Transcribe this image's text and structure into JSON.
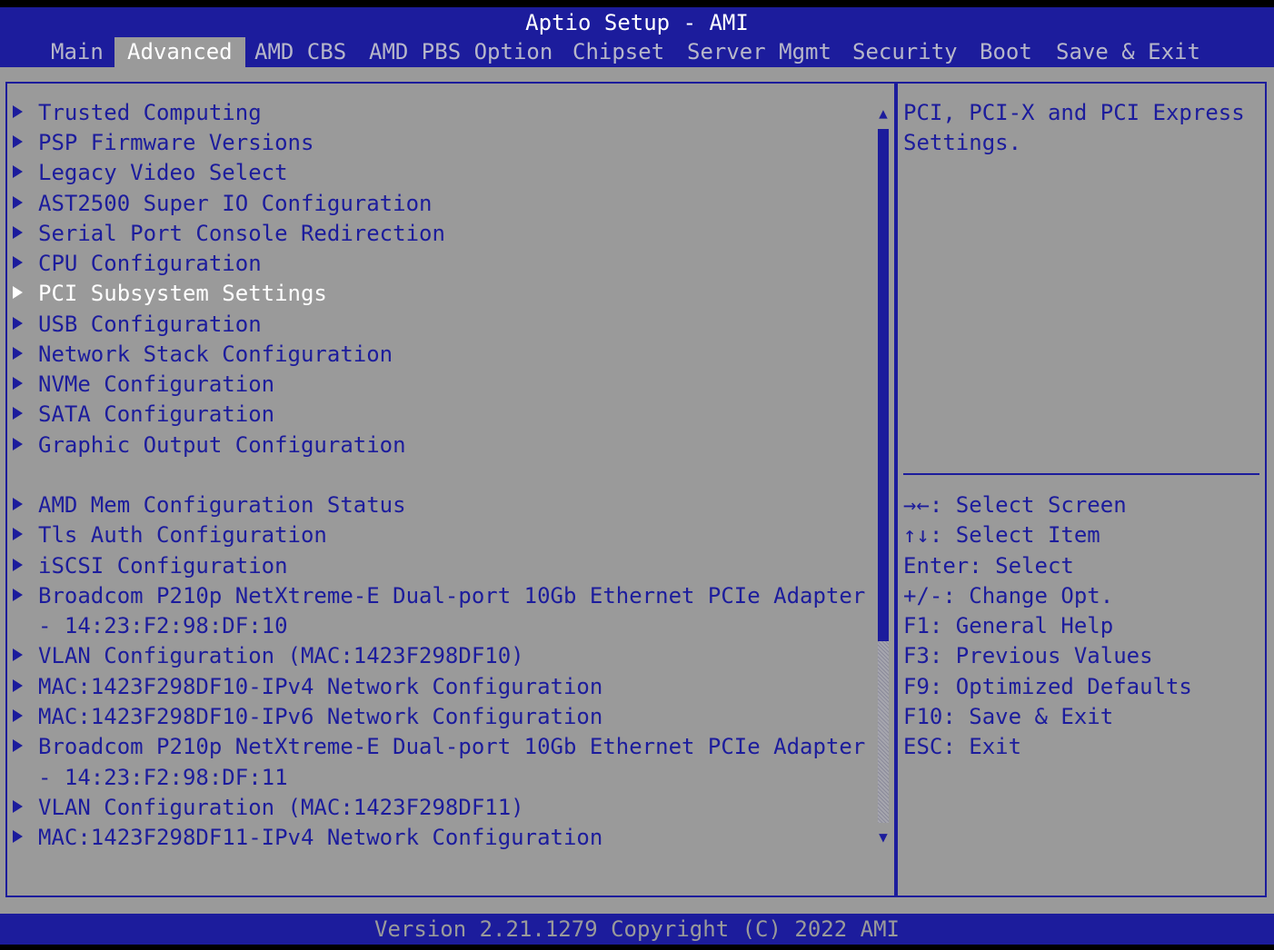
{
  "header": {
    "title": "Aptio Setup - AMI",
    "tabs": [
      {
        "label": "Main"
      },
      {
        "label": "Advanced"
      },
      {
        "label": "AMD CBS"
      },
      {
        "label": "AMD PBS Option"
      },
      {
        "label": "Chipset"
      },
      {
        "label": "Server Mgmt"
      },
      {
        "label": "Security"
      },
      {
        "label": "Boot"
      },
      {
        "label": "Save & Exit"
      }
    ],
    "active_tab": "Advanced"
  },
  "menu": {
    "items": [
      {
        "label": "Trusted Computing"
      },
      {
        "label": "PSP Firmware Versions"
      },
      {
        "label": "Legacy Video Select"
      },
      {
        "label": "AST2500 Super IO Configuration"
      },
      {
        "label": "Serial Port Console Redirection"
      },
      {
        "label": "CPU Configuration"
      },
      {
        "label": "PCI Subsystem Settings"
      },
      {
        "label": "USB Configuration"
      },
      {
        "label": "Network Stack Configuration"
      },
      {
        "label": "NVMe Configuration"
      },
      {
        "label": "SATA Configuration"
      },
      {
        "label": "Graphic Output Configuration"
      },
      {
        "label": "AMD Mem Configuration Status"
      },
      {
        "label": "Tls Auth Configuration"
      },
      {
        "label": "iSCSI Configuration"
      },
      {
        "label": "Broadcom P210p NetXtreme-E Dual-port 10Gb Ethernet PCIe Adapter",
        "continuation": "- 14:23:F2:98:DF:10"
      },
      {
        "label": "VLAN Configuration (MAC:1423F298DF10)"
      },
      {
        "label": "MAC:1423F298DF10-IPv4 Network Configuration"
      },
      {
        "label": "MAC:1423F298DF10-IPv6 Network Configuration"
      },
      {
        "label": "Broadcom P210p NetXtreme-E Dual-port 10Gb Ethernet PCIe Adapter",
        "continuation": "- 14:23:F2:98:DF:11"
      },
      {
        "label": "VLAN Configuration (MAC:1423F298DF11)"
      },
      {
        "label": "MAC:1423F298DF11-IPv4 Network Configuration"
      }
    ],
    "selected": "PCI Subsystem Settings",
    "scroll_position": 0.0
  },
  "help": {
    "description": "PCI, PCI-X and PCI Express Settings.",
    "keys": [
      {
        "text": "→←: Select Screen"
      },
      {
        "text": "↑↓: Select Item"
      },
      {
        "text": "Enter: Select"
      },
      {
        "text": "+/-: Change Opt."
      },
      {
        "text": "F1: General Help"
      },
      {
        "text": "F3: Previous Values"
      },
      {
        "text": "F9: Optimized Defaults"
      },
      {
        "text": "F10: Save & Exit"
      },
      {
        "text": "ESC: Exit"
      }
    ]
  },
  "footer": {
    "text": "Version 2.21.1279 Copyright (C) 2022 AMI"
  },
  "colors": {
    "primary_blue": "#1c1c9c",
    "panel_gray": "#9a9a9a",
    "highlight_white": "#ffffff"
  }
}
